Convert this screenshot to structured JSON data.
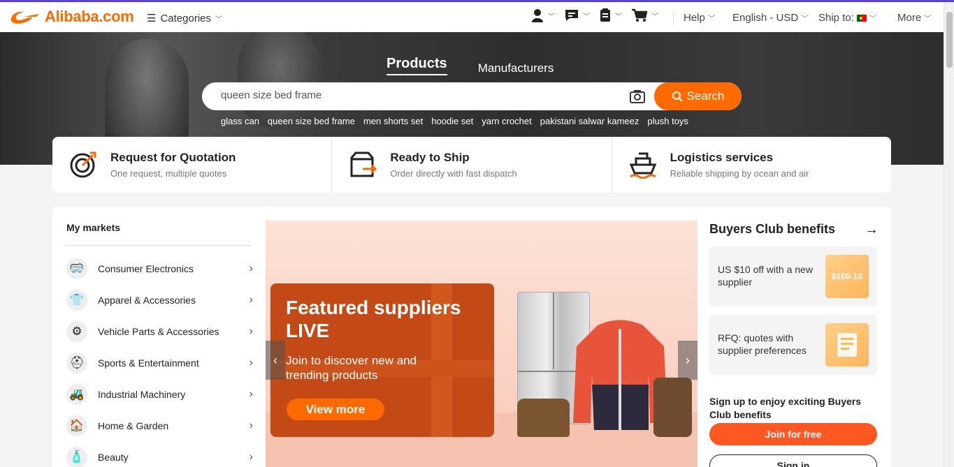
{
  "header": {
    "logo_text": "Alibaba.com",
    "categories_label": "Categories",
    "help_label": "Help",
    "language_label": "English - USD",
    "ship_to_label": "Ship to:",
    "more_label": "More",
    "icons": [
      "account-icon",
      "messages-icon",
      "orders-icon",
      "cart-icon"
    ]
  },
  "hero": {
    "tabs": [
      {
        "label": "Products",
        "active": true
      },
      {
        "label": "Manufacturers",
        "active": false
      }
    ],
    "search_value": "queen size bed frame",
    "search_button": "Search",
    "suggestions": [
      "glass can",
      "queen size bed frame",
      "men shorts set",
      "hoodie set",
      "yarn crochet",
      "pakistani salwar kameez",
      "plush toys"
    ]
  },
  "services": [
    {
      "title": "Request for Quotation",
      "subtitle": "One request, multiple quotes",
      "icon": "target-icon"
    },
    {
      "title": "Ready to Ship",
      "subtitle": "Order directly with fast dispatch",
      "icon": "box-arrow-icon"
    },
    {
      "title": "Logistics services",
      "subtitle": "Reliable shipping by ocean and air",
      "icon": "ship-icon"
    }
  ],
  "markets": {
    "title": "My markets",
    "items": [
      {
        "label": "Consumer Electronics",
        "icon": "vr-headset-icon"
      },
      {
        "label": "Apparel & Accessories",
        "icon": "tshirt-icon"
      },
      {
        "label": "Vehicle Parts & Accessories",
        "icon": "car-parts-icon"
      },
      {
        "label": "Sports & Entertainment",
        "icon": "helmet-icon"
      },
      {
        "label": "Industrial Machinery",
        "icon": "excavator-icon"
      },
      {
        "label": "Home & Garden",
        "icon": "home-garden-icon"
      },
      {
        "label": "Beauty",
        "icon": "perfume-icon"
      }
    ]
  },
  "banner": {
    "heading": "Featured suppliers LIVE",
    "subtext": "Join to discover new and trending products",
    "button": "View more"
  },
  "buyers_club": {
    "title": "Buyers Club benefits",
    "cards": [
      {
        "text": "US $10 off with a new supplier",
        "badge": "$100-10"
      },
      {
        "text": "RFQ: quotes with supplier preferences",
        "badge": ""
      }
    ],
    "signup_text": "Sign up to enjoy exciting Buyers Club benefits",
    "join_button": "Join for free",
    "signin_button": "Sign in"
  },
  "colors": {
    "accent": "#ff6a00",
    "join": "#ff5722",
    "banner_card": "#c34a17"
  }
}
